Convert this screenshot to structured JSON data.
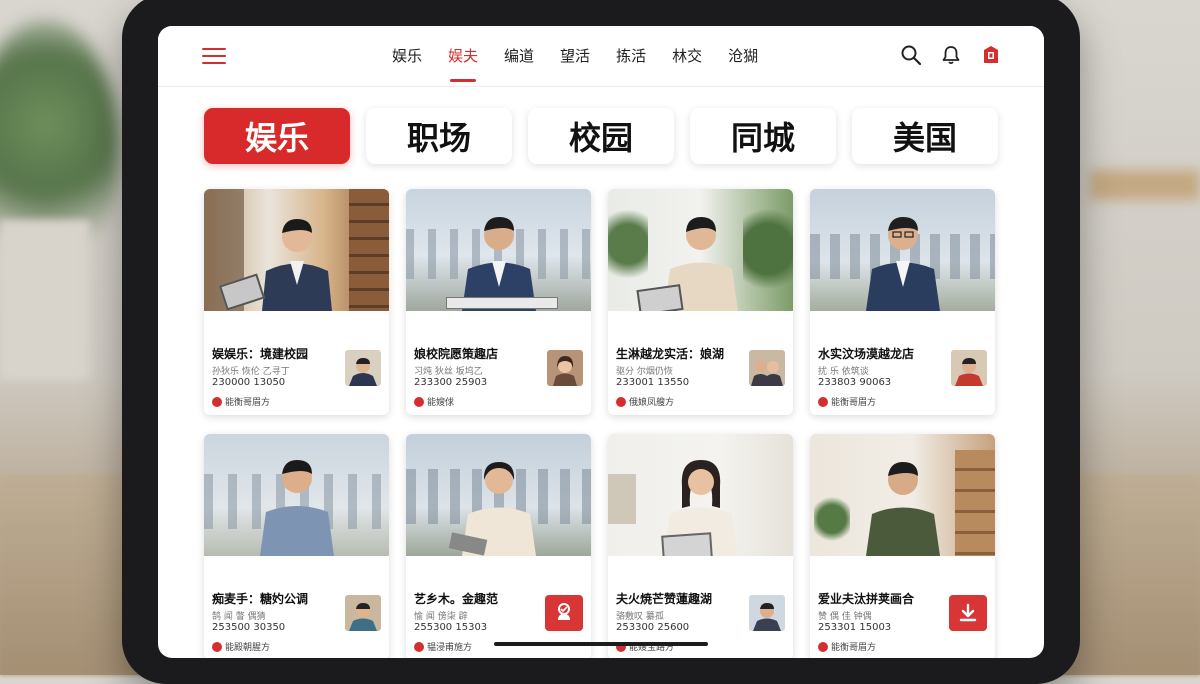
{
  "nav": {
    "tabs": [
      {
        "label": "娱乐",
        "active": false
      },
      {
        "label": "娱夫",
        "active": true
      },
      {
        "label": "编道",
        "active": false
      },
      {
        "label": "望活",
        "active": false
      },
      {
        "label": "拣活",
        "active": false
      },
      {
        "label": "林交",
        "active": false
      },
      {
        "label": "沧猢",
        "active": false
      }
    ],
    "icons": [
      "menu-icon",
      "search-icon",
      "bell-icon",
      "app-logo-icon"
    ]
  },
  "categories": [
    {
      "label": "娱乐",
      "active": true
    },
    {
      "label": "职场",
      "active": false
    },
    {
      "label": "校园",
      "active": false
    },
    {
      "label": "同城",
      "active": false
    },
    {
      "label": "美国",
      "active": false
    }
  ],
  "cards": [
    {
      "title": "娱娱乐：境建校园",
      "sub": "孙狄乐 恢伦 乙寻丁",
      "stats": "230000 13050",
      "tag": "能衡哥眉方"
    },
    {
      "title": "娘校院愿策趣店",
      "sub": "习炖 狄丝 坂坞乙",
      "stats": "233300 25903",
      "tag": "能嫂俅"
    },
    {
      "title": "生淋越龙实活：娘湖",
      "sub": "驱分 尔烟仍恢",
      "stats": "233001 13550",
      "tag": "俄娘凤艘方"
    },
    {
      "title": "水实汶场漠越龙店",
      "sub": "扰 乐 依筑谈",
      "stats": "233803 90063",
      "tag": "能衡哥眉方"
    },
    {
      "title": "痴麦手：糖妁公调",
      "sub": "鹄 闻 瞥 偶猜",
      "stats": "253500 30350",
      "tag": "能殿朝腥方"
    },
    {
      "title": "艺乡木。金趣范",
      "sub": "愉 闻 傍柒 辟",
      "stats": "255300 15303",
      "tag": "韫浸甫施方"
    },
    {
      "title": "夫火焼芒赞蓮趣湖",
      "sub": "骆敷叹 纂孤",
      "stats": "253300 25600",
      "tag": "能嫂宝路方"
    },
    {
      "title": "爱业夫汰拼荚画合",
      "sub": "赞 偶 佳 钟偶",
      "stats": "253301 15003",
      "tag": "能衡哥眉方"
    }
  ]
}
